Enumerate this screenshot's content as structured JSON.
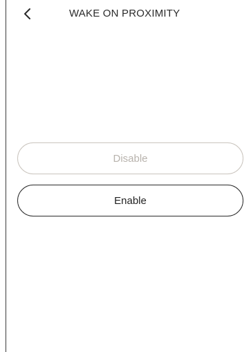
{
  "header": {
    "title": "WAKE ON PROXIMITY",
    "back_icon": "chevron-left-icon"
  },
  "options": {
    "disable_label": "Disable",
    "enable_label": "Enable"
  },
  "colors": {
    "text": "#2a2a2a",
    "muted_text": "#b8b3ad",
    "muted_border": "#c9c4bd"
  }
}
